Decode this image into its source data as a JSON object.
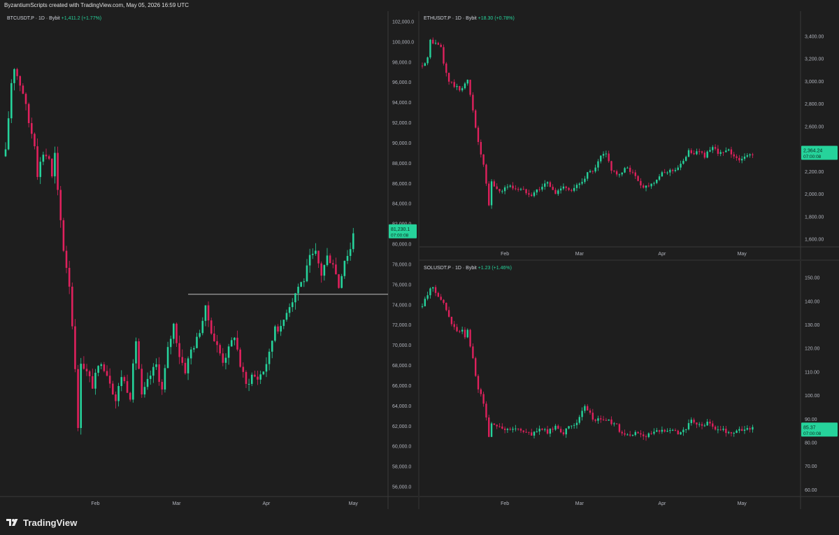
{
  "header": {
    "attribution": "ByzantiumScripts created with TradingView.com, May 05, 2026 16:59 UTC"
  },
  "brand": {
    "name": "TradingView",
    "icon": "tradingview-logo-icon"
  },
  "colors": {
    "up": "#26d39b",
    "down": "#e0215d",
    "background": "#1e1e1e",
    "grid": "#2b2b2b",
    "axis_text": "#b2b5be"
  },
  "chart_data": [
    {
      "type": "candlestick",
      "symbol": "BTCUSDT.P",
      "legend": {
        "symbol": "BTCUSDT.P · 1D · Bybit",
        "change": "+1,411.2 (+1.77%)"
      },
      "yticks": [
        56000,
        58000,
        60000,
        62000,
        64000,
        66000,
        68000,
        70000,
        72000,
        74000,
        76000,
        78000,
        80000,
        82000,
        84000,
        86000,
        88000,
        90000,
        92000,
        94000,
        96000,
        98000,
        100000,
        102000
      ],
      "ytick_labels": [
        "56,000.0",
        "58,000.0",
        "60,000.0",
        "62,000.0",
        "64,000.0",
        "66,000.0",
        "68,000.0",
        "70,000.0",
        "72,000.0",
        "74,000.0",
        "76,000.0",
        "78,000.0",
        "80,000.0",
        "82,000.0",
        "84,000.0",
        "86,000.0",
        "88,000.0",
        "90,000.0",
        "92,000.0",
        "94,000.0",
        "96,000.0",
        "98,000.0",
        "100,000.0",
        "102,000.0"
      ],
      "ylim": [
        55000,
        103000
      ],
      "x_labels": [
        "Feb",
        "Mar",
        "Apr",
        "May"
      ],
      "x_label_days": [
        31,
        59,
        90,
        120
      ],
      "day_range": [
        0,
        132
      ],
      "price_label": {
        "price": "81,230.1",
        "countdown": "07:00:08",
        "value": 81230
      },
      "hline": {
        "value": 75000,
        "from_day": 63,
        "to_day": 132
      },
      "anchors": [
        [
          0,
          89000
        ],
        [
          2,
          96000
        ],
        [
          3,
          97500
        ],
        [
          6,
          95000
        ],
        [
          8,
          92000
        ],
        [
          10,
          90000
        ],
        [
          11,
          87000
        ],
        [
          13,
          89000
        ],
        [
          15,
          88500
        ],
        [
          16,
          86500
        ],
        [
          17,
          88800
        ],
        [
          18,
          85000
        ],
        [
          20,
          79500
        ],
        [
          22,
          76000
        ],
        [
          24,
          68000
        ],
        [
          25,
          61500
        ],
        [
          26,
          68500
        ],
        [
          30,
          66000
        ],
        [
          33,
          68500
        ],
        [
          36,
          66500
        ],
        [
          38,
          64500
        ],
        [
          40,
          67000
        ],
        [
          43,
          65000
        ],
        [
          45,
          70500
        ],
        [
          47,
          64800
        ],
        [
          50,
          67000
        ],
        [
          52,
          68000
        ],
        [
          54,
          65500
        ],
        [
          56,
          69500
        ],
        [
          58,
          72000
        ],
        [
          60,
          69000
        ],
        [
          62,
          67500
        ],
        [
          64,
          69500
        ],
        [
          66,
          70500
        ],
        [
          69,
          73500
        ],
        [
          72,
          70500
        ],
        [
          75,
          68500
        ],
        [
          77,
          69500
        ],
        [
          79,
          71000
        ],
        [
          81,
          68000
        ],
        [
          83,
          66000
        ],
        [
          85,
          67000
        ],
        [
          87,
          66700
        ],
        [
          89,
          67500
        ],
        [
          91,
          69000
        ],
        [
          93,
          72000
        ],
        [
          95,
          71500
        ],
        [
          97,
          73500
        ],
        [
          99,
          74500
        ],
        [
          101,
          75800
        ],
        [
          103,
          76500
        ],
        [
          105,
          78500
        ],
        [
          107,
          79000
        ],
        [
          109,
          77000
        ],
        [
          111,
          78700
        ],
        [
          113,
          78200
        ],
        [
          115,
          75800
        ],
        [
          117,
          78500
        ],
        [
          119,
          79500
        ],
        [
          120,
          81200
        ]
      ]
    },
    {
      "type": "candlestick",
      "symbol": "ETHUSDT.P",
      "legend": {
        "symbol": "ETHUSDT.P · 1D · Bybit",
        "change": "+18.30 (+0.78%)"
      },
      "yticks": [
        1600,
        1800,
        2000,
        2200,
        2400,
        2600,
        2800,
        3000,
        3200,
        3400,
        3600
      ],
      "ytick_labels": [
        "1,600.00",
        "1,800.00",
        "2,000.00",
        "2,200.00",
        "2,400.00",
        "2,600.00",
        "2,800.00",
        "3,000.00",
        "3,200.00",
        "3,400.00",
        "3,600.00"
      ],
      "ylim": [
        1530,
        3620
      ],
      "x_labels": [
        "Feb",
        "Mar",
        "Apr",
        "May"
      ],
      "x_label_days": [
        31,
        59,
        90,
        120
      ],
      "day_range": [
        0,
        142
      ],
      "price_label": {
        "price": "2,364.24",
        "countdown": "07:00:08",
        "value": 2364
      },
      "anchors": [
        [
          0,
          3150
        ],
        [
          2,
          3200
        ],
        [
          3,
          3360
        ],
        [
          5,
          3330
        ],
        [
          7,
          3300
        ],
        [
          8,
          3150
        ],
        [
          10,
          3000
        ],
        [
          12,
          2960
        ],
        [
          14,
          2920
        ],
        [
          16,
          2980
        ],
        [
          17,
          3000
        ],
        [
          19,
          2750
        ],
        [
          21,
          2450
        ],
        [
          23,
          2250
        ],
        [
          25,
          1900
        ],
        [
          26,
          2100
        ],
        [
          29,
          2020
        ],
        [
          32,
          2070
        ],
        [
          35,
          2050
        ],
        [
          38,
          2030
        ],
        [
          41,
          2000
        ],
        [
          44,
          2050
        ],
        [
          47,
          2100
        ],
        [
          50,
          2000
        ],
        [
          53,
          2080
        ],
        [
          56,
          2020
        ],
        [
          59,
          2090
        ],
        [
          62,
          2180
        ],
        [
          65,
          2220
        ],
        [
          67,
          2330
        ],
        [
          69,
          2350
        ],
        [
          71,
          2220
        ],
        [
          74,
          2160
        ],
        [
          77,
          2240
        ],
        [
          80,
          2150
        ],
        [
          83,
          2060
        ],
        [
          86,
          2090
        ],
        [
          89,
          2160
        ],
        [
          92,
          2200
        ],
        [
          95,
          2220
        ],
        [
          98,
          2280
        ],
        [
          100,
          2400
        ],
        [
          102,
          2350
        ],
        [
          104,
          2380
        ],
        [
          106,
          2340
        ],
        [
          109,
          2400
        ],
        [
          112,
          2360
        ],
        [
          115,
          2380
        ],
        [
          118,
          2320
        ],
        [
          120,
          2300
        ],
        [
          122,
          2340
        ],
        [
          124,
          2360
        ]
      ]
    },
    {
      "type": "candlestick",
      "symbol": "SOLUSDT.P",
      "legend": {
        "symbol": "SOLUSDT.P · 1D · Bybit",
        "change": "+1.23 (+1.46%)"
      },
      "yticks": [
        60,
        70,
        80,
        90,
        100,
        110,
        120,
        130,
        140,
        150
      ],
      "ytick_labels": [
        "60.00",
        "70.00",
        "80.00",
        "90.00",
        "100.00",
        "110.00",
        "120.00",
        "130.00",
        "140.00",
        "150.00"
      ],
      "ylim": [
        57,
        157
      ],
      "x_labels": [
        "Feb",
        "Mar",
        "Apr",
        "May"
      ],
      "x_label_days": [
        31,
        59,
        90,
        120
      ],
      "day_range": [
        0,
        142
      ],
      "price_label": {
        "price": "85.37",
        "countdown": "07:00:08",
        "value": 85.4
      },
      "anchors": [
        [
          0,
          138
        ],
        [
          2,
          143
        ],
        [
          3,
          146
        ],
        [
          5,
          144
        ],
        [
          7,
          141
        ],
        [
          9,
          136
        ],
        [
          11,
          130
        ],
        [
          13,
          127
        ],
        [
          15,
          127
        ],
        [
          16,
          125
        ],
        [
          17,
          127
        ],
        [
          19,
          115
        ],
        [
          21,
          103
        ],
        [
          23,
          97
        ],
        [
          25,
          83
        ],
        [
          26,
          88
        ],
        [
          29,
          87
        ],
        [
          32,
          85
        ],
        [
          35,
          86
        ],
        [
          38,
          85
        ],
        [
          41,
          83
        ],
        [
          44,
          86
        ],
        [
          47,
          84
        ],
        [
          50,
          87
        ],
        [
          53,
          84
        ],
        [
          56,
          87
        ],
        [
          59,
          90
        ],
        [
          61,
          95
        ],
        [
          63,
          92
        ],
        [
          65,
          89
        ],
        [
          67,
          90
        ],
        [
          70,
          89
        ],
        [
          73,
          87
        ],
        [
          75,
          83
        ],
        [
          78,
          83
        ],
        [
          81,
          84
        ],
        [
          84,
          83
        ],
        [
          87,
          84
        ],
        [
          90,
          85
        ],
        [
          93,
          86
        ],
        [
          96,
          84
        ],
        [
          99,
          86
        ],
        [
          101,
          89
        ],
        [
          104,
          87
        ],
        [
          107,
          88
        ],
        [
          110,
          86
        ],
        [
          113,
          85
        ],
        [
          116,
          84
        ],
        [
          119,
          85
        ],
        [
          122,
          86
        ],
        [
          124,
          86
        ]
      ]
    }
  ]
}
